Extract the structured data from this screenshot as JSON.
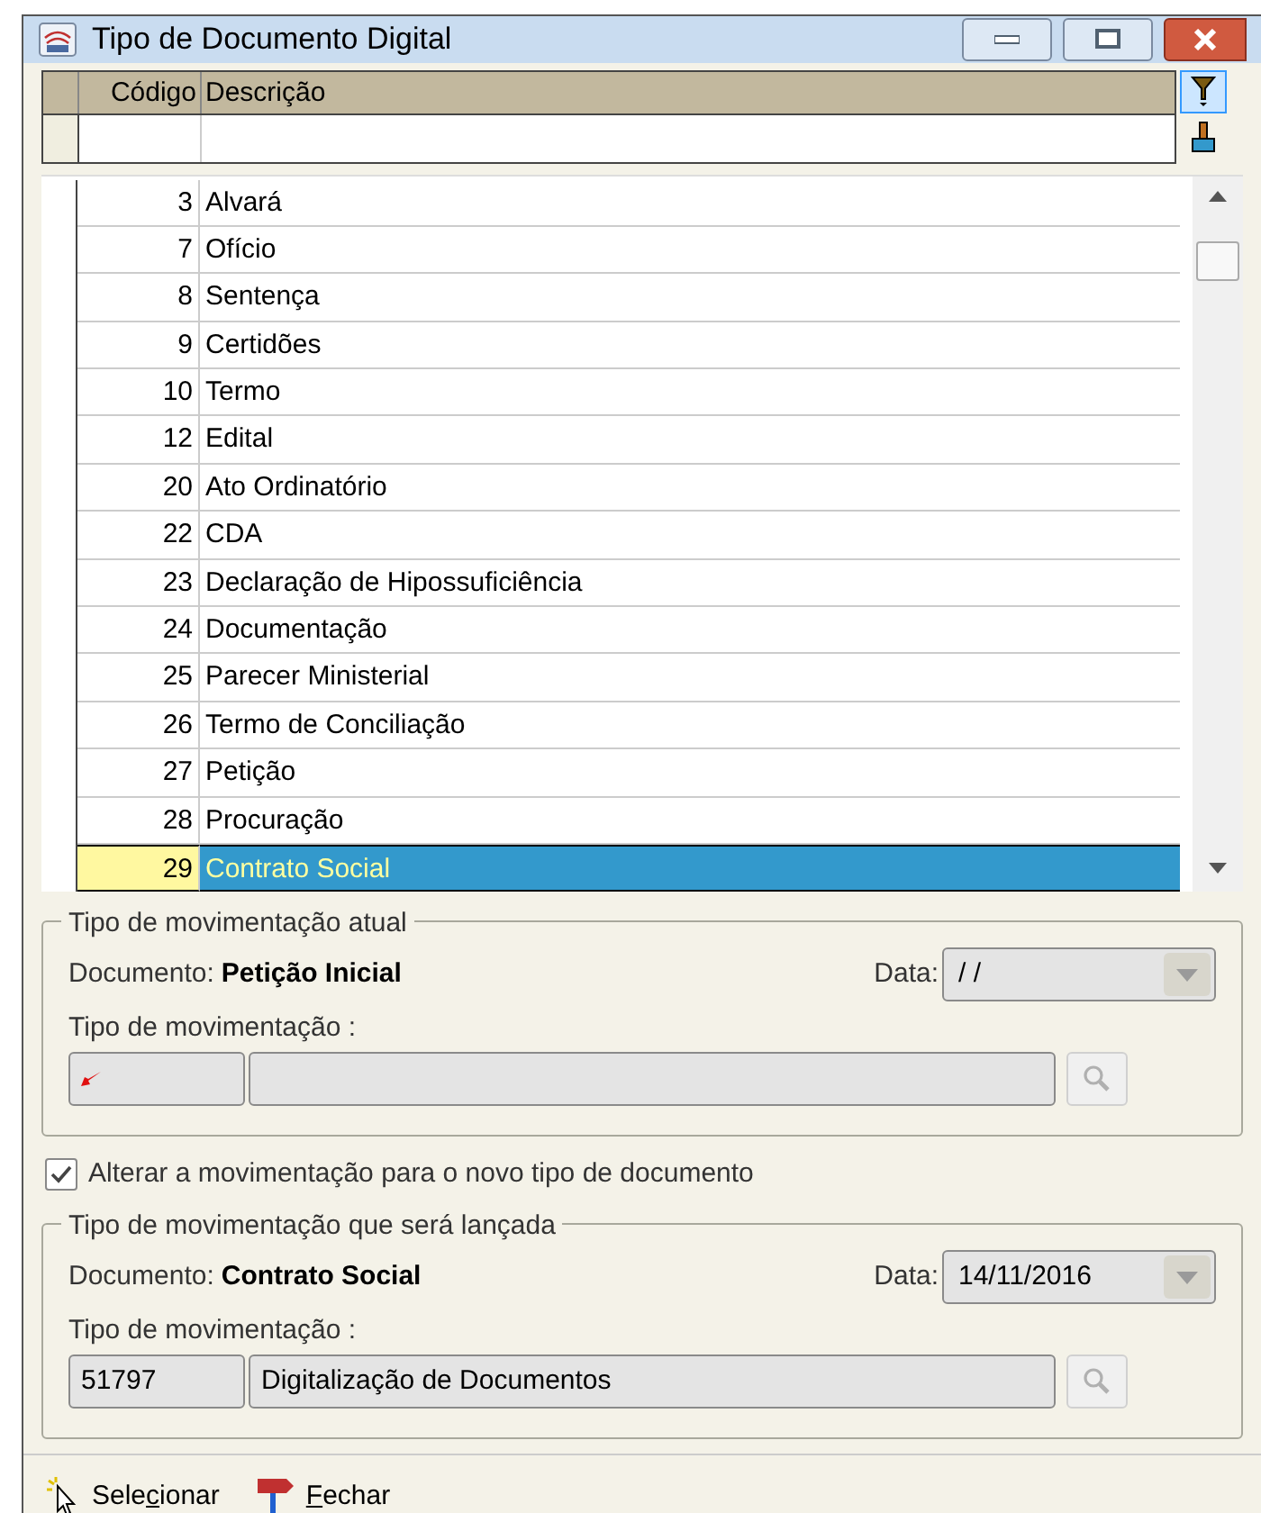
{
  "window": {
    "title": "Tipo de Documento Digital"
  },
  "table": {
    "columns": [
      "Código",
      "Descrição"
    ],
    "rows": [
      {
        "code": "3",
        "description": "Alvará",
        "selected": false
      },
      {
        "code": "7",
        "description": "Ofício",
        "selected": false
      },
      {
        "code": "8",
        "description": "Sentença",
        "selected": false
      },
      {
        "code": "9",
        "description": "Certidões",
        "selected": false
      },
      {
        "code": "10",
        "description": "Termo",
        "selected": false
      },
      {
        "code": "12",
        "description": "Edital",
        "selected": false
      },
      {
        "code": "20",
        "description": "Ato Ordinatório",
        "selected": false
      },
      {
        "code": "22",
        "description": "CDA",
        "selected": false
      },
      {
        "code": "23",
        "description": "Declaração de Hipossuficiência",
        "selected": false
      },
      {
        "code": "24",
        "description": "Documentação",
        "selected": false
      },
      {
        "code": "25",
        "description": "Parecer Ministerial",
        "selected": false
      },
      {
        "code": "26",
        "description": "Termo de Conciliação",
        "selected": false
      },
      {
        "code": "27",
        "description": "Petição",
        "selected": false
      },
      {
        "code": "28",
        "description": "Procuração",
        "selected": false
      },
      {
        "code": "29",
        "description": "Contrato Social",
        "selected": true
      }
    ]
  },
  "current_movement": {
    "title": "Tipo de movimentação atual",
    "document_label": "Documento:",
    "document": "Petição Inicial",
    "date_label": "Data:",
    "date": "/ /",
    "type_label": "Tipo de movimentação :"
  },
  "change_movement": {
    "label": "Alterar a movimentação para o novo tipo de documento",
    "checked": true
  },
  "new_movement": {
    "title": "Tipo de movimentação que será lançada",
    "document_label": "Documento:",
    "document": "Contrato Social",
    "date_label": "Data:",
    "date": "14/11/2016",
    "type_label": "Tipo de movimentação :",
    "type_code": "51797",
    "type_description": "Digitalização de Documentos"
  },
  "buttons": [
    {
      "kind": "select",
      "label_before": "Sele",
      "accelerator": "c",
      "label_after": "ionar"
    },
    {
      "kind": "close",
      "accelerator": "F",
      "label_after": "echar"
    }
  ]
}
